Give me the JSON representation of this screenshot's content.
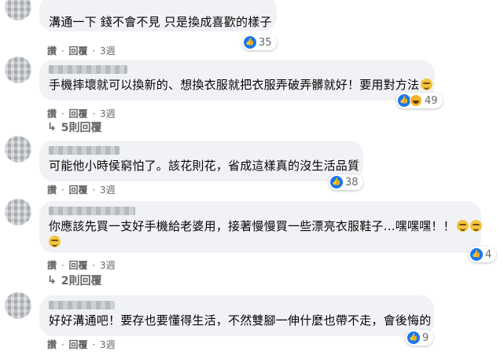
{
  "actions": {
    "like": "讚",
    "reply": "回覆",
    "sep": "·"
  },
  "comments": [
    {
      "text": "溝通一下 錢不會不見 只是換成喜歡的樣子",
      "reaction_count": "35",
      "time": "3週"
    },
    {
      "text": "手機摔壞就可以換新的、想換衣服就把衣服弄破弄髒就好！要用對方法",
      "reaction_count": "49",
      "time": "3週",
      "replies": "5則回覆"
    },
    {
      "text": "可能他小時侯窮怕了。該花則花，省成這樣真的沒生活品質",
      "reaction_count": "38",
      "time": "3週"
    },
    {
      "text": "你應該先買一支好手機給老婆用，接著慢慢買一些漂亮衣服鞋子…嘿嘿嘿！！",
      "reaction_count": "4",
      "time": "3週",
      "replies": "2則回覆"
    },
    {
      "text": "好好溝通吧！要存也要懂得生活，不然雙腳一伸什麼也帶不走，會後悔的",
      "reaction_count": "9",
      "time": "3週"
    }
  ],
  "colors": {
    "bubble": "#f0f2f5",
    "like_blue": "#1877f2",
    "meta_gray": "#65676b"
  },
  "icons": [
    "like-icon",
    "haha-icon",
    "sad-icon",
    "smile-emoji",
    "reply-arrow-icon"
  ]
}
